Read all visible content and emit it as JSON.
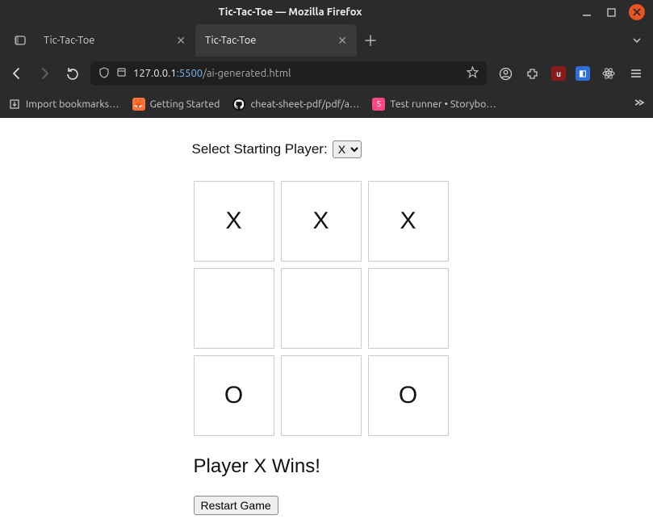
{
  "window": {
    "title": "Tic-Tac-Toe — Mozilla Firefox"
  },
  "tabs": [
    {
      "title": "Tic-Tac-Toe",
      "active": false
    },
    {
      "title": "Tic-Tac-Toe",
      "active": true
    }
  ],
  "url": {
    "host": "127.0.0.1",
    "port": ":5500",
    "path": "/ai-generated.html"
  },
  "bookmarks": [
    {
      "label": "Import bookmarks…",
      "icon": "import"
    },
    {
      "label": "Getting Started",
      "icon": "firefox"
    },
    {
      "label": "cheat-sheet-pdf/pdf/a…",
      "icon": "github"
    },
    {
      "label": "Test runner • Storybo…",
      "icon": "storybook"
    }
  ],
  "game": {
    "selector_label": "Select Starting Player:",
    "selector_value": "X",
    "board": [
      "X",
      "X",
      "X",
      "",
      "",
      "",
      "O",
      "",
      "O"
    ],
    "status": "Player X Wins!",
    "restart_label": "Restart Game"
  }
}
